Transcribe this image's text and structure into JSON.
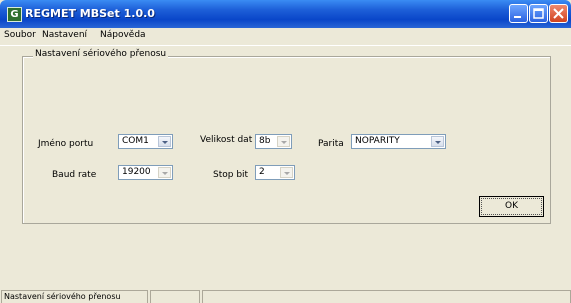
{
  "window": {
    "icon_letter": "G",
    "title": "REGMET MBSet 1.0.0",
    "controls": [
      "minimize",
      "maximize",
      "close"
    ]
  },
  "menu": [
    "Soubor",
    "Nastavení",
    "Nápověda"
  ],
  "group": {
    "label": "Nastavení sériového přenosu",
    "port": {
      "label": "Jméno portu",
      "value": "COM1"
    },
    "data_size": {
      "label": "Velikost dat",
      "value": "8b"
    },
    "parity": {
      "label": "Parita",
      "value": "NOPARITY"
    },
    "baud": {
      "label": "Baud rate",
      "value": "19200"
    },
    "stop": {
      "label": "Stop bit",
      "value": "2"
    },
    "ok_label": "OK"
  },
  "status": {
    "pane1": "Nastavení sériového přenosu",
    "pane2": "",
    "pane3": ""
  }
}
